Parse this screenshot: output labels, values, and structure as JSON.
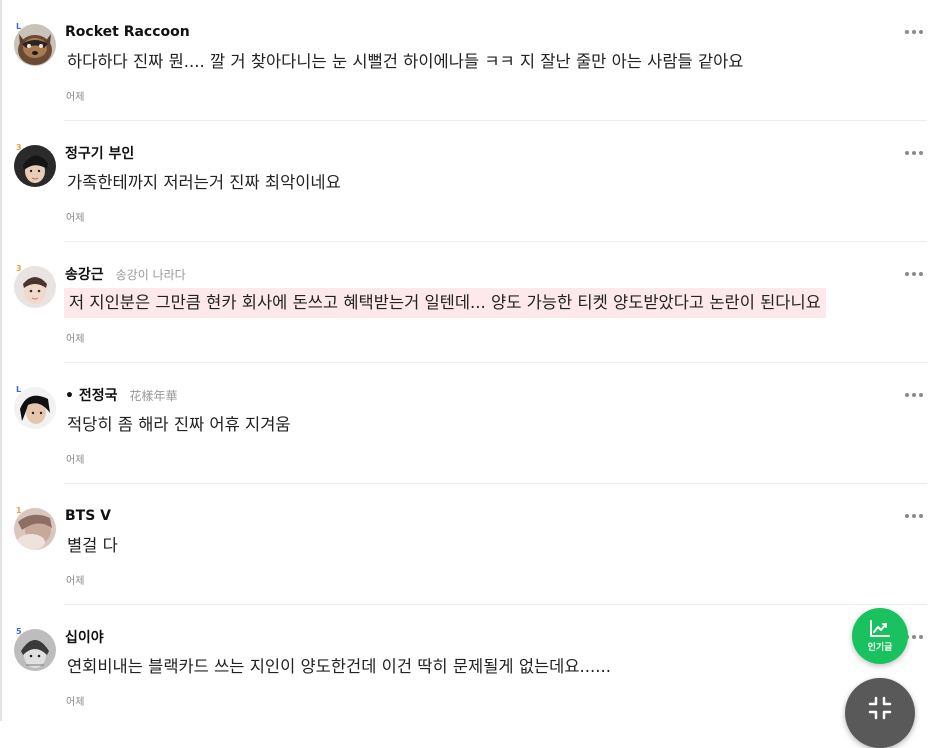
{
  "comments": [
    {
      "username": "Rocket Raccoon",
      "subtitle": "",
      "level": "L",
      "text": "하다하다 진짜 뭔.... 깔 거 찾아다니는 눈 시뻘건 하이에나들 ㅋㅋ 지 잘난 줄만 아는 사람들 같아요",
      "time": "어제",
      "highlighted": false,
      "avatar_icon": "raccoon-avatar"
    },
    {
      "username": "정구기 부인",
      "subtitle": "",
      "level": "3",
      "text": "가족한테까지 저러는거 진짜 최악이네요",
      "time": "어제",
      "highlighted": false,
      "avatar_icon": "person-avatar"
    },
    {
      "username": "송강근",
      "subtitle": "송강이 나라다",
      "level": "3",
      "text": "저 지인분은 그만큼 현카 회사에 돈쓰고 혜택받는거 일텐데... 양도 가능한 티켓 양도받았다고 논란이 된다니요",
      "time": "어제",
      "highlighted": true,
      "avatar_icon": "person-avatar"
    },
    {
      "username": "• 전정국",
      "subtitle": "花樣年華",
      "level": "L",
      "text": "적당히 좀 해라 진짜 어휴 지겨움",
      "time": "어제",
      "highlighted": false,
      "avatar_icon": "person-avatar"
    },
    {
      "username": "BTS V",
      "subtitle": "",
      "level": "1",
      "text": "별걸 다",
      "time": "어제",
      "highlighted": false,
      "avatar_icon": "person-avatar"
    },
    {
      "username": "십이야",
      "subtitle": "",
      "level": "5",
      "text": "연회비내는 블랙카드 쓰는 지인이 양도한건데 이건 딱히 문제될게 없는데요......",
      "time": "어제",
      "highlighted": false,
      "avatar_icon": "person-avatar"
    }
  ],
  "fab_popular": {
    "label": "인기글",
    "icon": "trending-chart-icon",
    "color": "#19c15f"
  },
  "fab_scroll": {
    "icon": "collapse-arrows-icon",
    "color": "#595959"
  }
}
